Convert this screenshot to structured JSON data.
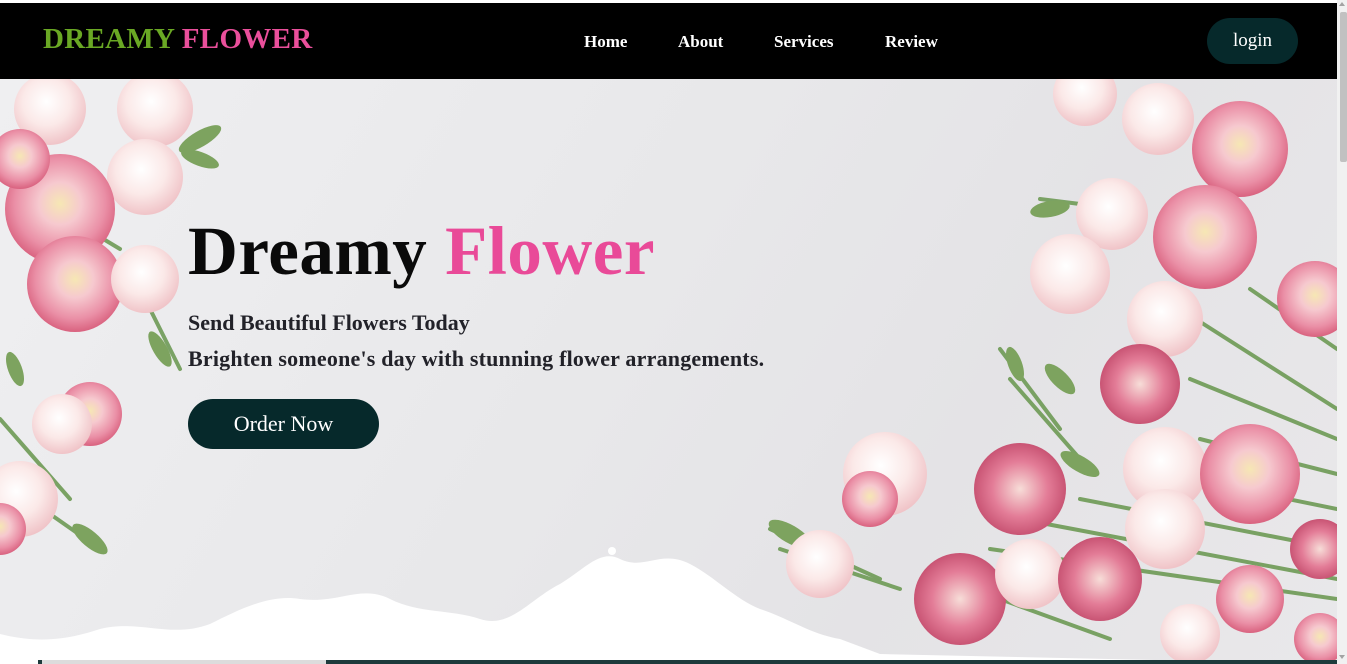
{
  "brand": {
    "part1": "DREAMY",
    "part2": "FLOWER"
  },
  "nav": [
    {
      "label": "Home"
    },
    {
      "label": "About"
    },
    {
      "label": "Services"
    },
    {
      "label": "Review"
    }
  ],
  "login_label": "login",
  "hero": {
    "title_part1": "Dreamy",
    "title_part2": "Flower",
    "subtitle1": "Send Beautiful Flowers Today",
    "subtitle2": "Brighten someone's day with stunning flower arrangements.",
    "cta_label": "Order Now"
  },
  "colors": {
    "brand_green": "#6aa824",
    "brand_pink": "#ea4f9b",
    "button_dark_teal": "#06292b",
    "navbar_bg": "#000000"
  }
}
